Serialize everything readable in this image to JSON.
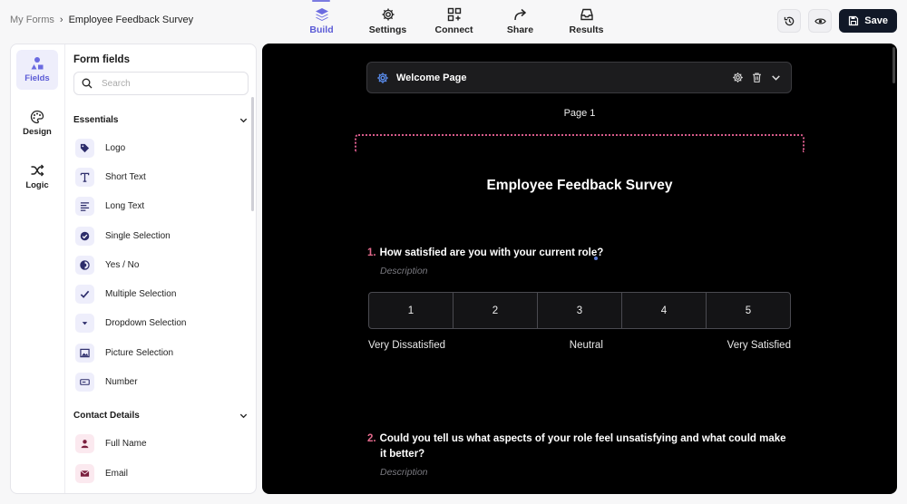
{
  "breadcrumb": {
    "parent": "My Forms",
    "separator": "›",
    "current": "Employee Feedback Survey"
  },
  "nav": [
    {
      "label": "Build",
      "icon": "layers-icon",
      "active": true
    },
    {
      "label": "Settings",
      "icon": "gear-icon",
      "active": false
    },
    {
      "label": "Connect",
      "icon": "grid-plus-icon",
      "active": false
    },
    {
      "label": "Share",
      "icon": "share-arrow-icon",
      "active": false
    },
    {
      "label": "Results",
      "icon": "inbox-icon",
      "active": false
    }
  ],
  "actions": {
    "history_icon": "history-icon",
    "preview_icon": "eye-icon",
    "save_label": "Save"
  },
  "rail": [
    {
      "label": "Fields",
      "icon": "shapes-icon",
      "active": true
    },
    {
      "label": "Design",
      "icon": "palette-icon",
      "active": false
    },
    {
      "label": "Logic",
      "icon": "shuffle-icon",
      "active": false
    }
  ],
  "fields_panel": {
    "title": "Form fields",
    "search_placeholder": "Search",
    "sections": [
      {
        "name": "Essentials",
        "items": [
          {
            "label": "Logo",
            "icon": "tag-icon"
          },
          {
            "label": "Short Text",
            "icon": "text-t-icon"
          },
          {
            "label": "Long Text",
            "icon": "lines-icon"
          },
          {
            "label": "Single Selection",
            "icon": "check-circle-icon"
          },
          {
            "label": "Yes / No",
            "icon": "half-circle-icon"
          },
          {
            "label": "Multiple Selection",
            "icon": "checkmark-icon"
          },
          {
            "label": "Dropdown Selection",
            "icon": "dropdown-icon"
          },
          {
            "label": "Picture Selection",
            "icon": "image-icon"
          },
          {
            "label": "Number",
            "icon": "number-icon"
          }
        ]
      },
      {
        "name": "Contact Details",
        "items": [
          {
            "label": "Full Name",
            "icon": "person-icon"
          },
          {
            "label": "Email",
            "icon": "envelope-icon"
          }
        ]
      }
    ]
  },
  "canvas": {
    "welcome_title": "Welcome Page",
    "page_label": "Page 1",
    "survey_title": "Employee Feedback Survey",
    "questions": [
      {
        "number": "1.",
        "text": "How satisfied are you with your current role?",
        "description": "Description"
      },
      {
        "number": "2.",
        "text": "Could you tell us what aspects of your role feel unsatisfying and what could make it better?",
        "description": "Description"
      }
    ],
    "rating": {
      "options": [
        "1",
        "2",
        "3",
        "4",
        "5"
      ],
      "low_label": "Very Dissatisfied",
      "mid_label": "Neutral",
      "high_label": "Very Satisfied"
    }
  },
  "colors": {
    "accent": "#5b5bd6",
    "question_number": "#e46a8c",
    "save_bg": "#111827",
    "canvas_bg": "#000000"
  }
}
